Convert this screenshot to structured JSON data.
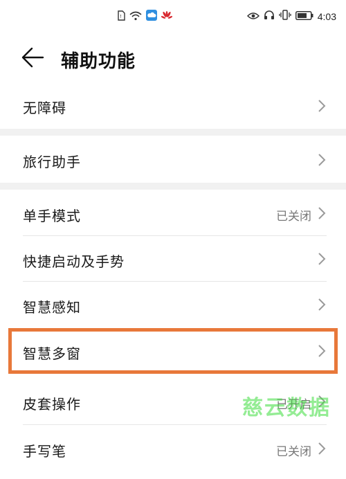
{
  "status_bar": {
    "time": "4:03",
    "icons_left": [
      "sim-card-icon",
      "wifi-icon",
      "cloud-icon",
      "huawei-logo-icon"
    ],
    "icons_right": [
      "eye-icon",
      "headset-icon",
      "vibrate-icon",
      "battery-icon"
    ]
  },
  "header": {
    "title": "辅助功能",
    "back_icon": "back-arrow-icon"
  },
  "sections": [
    {
      "items": [
        {
          "label": "无障碍",
          "value": ""
        }
      ]
    },
    {
      "items": [
        {
          "label": "旅行助手",
          "value": ""
        }
      ]
    },
    {
      "items": [
        {
          "label": "单手模式",
          "value": "已关闭"
        },
        {
          "label": "快捷启动及手势",
          "value": ""
        },
        {
          "label": "智慧感知",
          "value": ""
        },
        {
          "label": "智慧多窗",
          "value": ""
        },
        {
          "label": "皮套操作",
          "value": "已开启"
        },
        {
          "label": "手写笔",
          "value": "已关闭"
        }
      ]
    }
  ],
  "highlight": {
    "target": "智慧多窗",
    "color": "#e8783a"
  },
  "watermark": {
    "text": "慈云数据",
    "color": "#3cdc3c"
  },
  "colors": {
    "background": "#ffffff",
    "section_gap": "#f1f1f1",
    "divider": "#e6e6e6",
    "value_text": "#777777"
  }
}
